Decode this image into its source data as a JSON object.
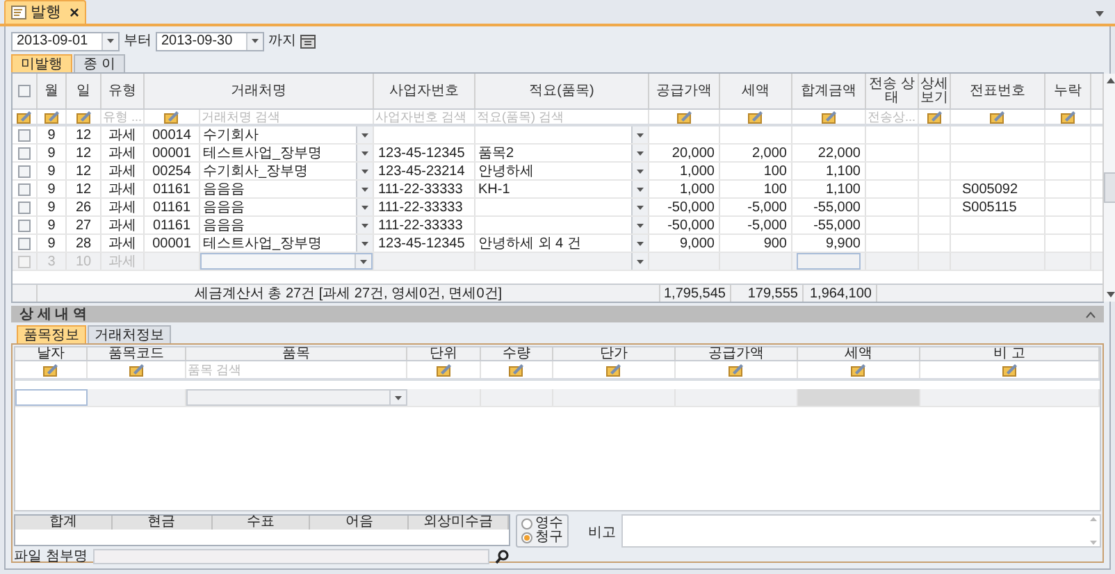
{
  "doc_tab": {
    "title": "발행",
    "close": "×",
    "selected": true
  },
  "period": {
    "from": "2013-09-01",
    "from_label": "부터",
    "to": "2013-09-30",
    "to_label": "까지"
  },
  "status_tabs": [
    {
      "label": "미발행",
      "selected": true
    },
    {
      "label": "종 이",
      "selected": false
    }
  ],
  "table": {
    "select_all_checked": false,
    "columns": [
      "월",
      "일",
      "유형",
      "거래처명",
      "사업자번호",
      "적요(품목)",
      "공급가액",
      "세액",
      "합계금액",
      "전송 상태",
      "상세 보기",
      "전표번호",
      "누락"
    ],
    "filters": [
      {
        "kind": "icon"
      },
      {
        "kind": "icon"
      },
      {
        "kind": "icon"
      },
      {
        "kind": "search",
        "placeholder": "유형 ..."
      },
      {
        "kind": "icon"
      },
      {
        "kind": "search",
        "placeholder": "거래처명 검색"
      },
      {
        "kind": "search",
        "placeholder": "사업자번호 검색"
      },
      {
        "kind": "search",
        "placeholder": "적요(품목) 검색"
      },
      {
        "kind": "icon"
      },
      {
        "kind": "icon"
      },
      {
        "kind": "icon"
      },
      {
        "kind": "search",
        "placeholder": "전송상..."
      },
      {
        "kind": "icon"
      },
      {
        "kind": "icon"
      },
      {
        "kind": "icon"
      }
    ],
    "rows": [
      {
        "kind": "data",
        "checked": false,
        "month": "9",
        "day": "12",
        "type": "과세",
        "code": "00014",
        "name": "수기회사",
        "bizno": "",
        "memo": "",
        "supply": "",
        "tax": "",
        "total": "",
        "slip": ""
      },
      {
        "kind": "data",
        "checked": false,
        "month": "9",
        "day": "12",
        "type": "과세",
        "code": "00001",
        "name": "테스트사업_장부명",
        "bizno": "123-45-12345",
        "memo": "품목2",
        "supply": "20,000",
        "tax": "2,000",
        "total": "22,000",
        "slip": ""
      },
      {
        "kind": "data",
        "checked": false,
        "month": "9",
        "day": "12",
        "type": "과세",
        "code": "00254",
        "name": "수기회사_장부명",
        "bizno": "123-45-23214",
        "memo": "안녕하세",
        "supply": "1,000",
        "tax": "100",
        "total": "1,100",
        "slip": ""
      },
      {
        "kind": "data",
        "checked": false,
        "month": "9",
        "day": "12",
        "type": "과세",
        "code": "01161",
        "name": "음음음",
        "bizno": "111-22-33333",
        "memo": "KH-1",
        "supply": "1,000",
        "tax": "100",
        "total": "1,100",
        "slip": "S005092"
      },
      {
        "kind": "data",
        "checked": false,
        "month": "9",
        "day": "26",
        "type": "과세",
        "code": "01161",
        "name": "음음음",
        "bizno": "111-22-33333",
        "memo": "",
        "supply": "-50,000",
        "tax": "-5,000",
        "total": "-55,000",
        "slip": "S005115"
      },
      {
        "kind": "data",
        "checked": false,
        "month": "9",
        "day": "27",
        "type": "과세",
        "code": "01161",
        "name": "음음음",
        "bizno": "111-22-33333",
        "memo": "",
        "supply": "-50,000",
        "tax": "-5,000",
        "total": "-55,000",
        "slip": ""
      },
      {
        "kind": "data",
        "checked": false,
        "month": "9",
        "day": "28",
        "type": "과세",
        "code": "00001",
        "name": "테스트사업_장부명",
        "bizno": "123-45-12345",
        "memo": "안녕하세 외 4 건",
        "supply": "9,000",
        "tax": "900",
        "total": "9,900",
        "slip": ""
      },
      {
        "kind": "new",
        "checked": false,
        "month": "3",
        "day": "10",
        "type": "과세",
        "code": "",
        "name": "",
        "bizno": "",
        "memo": "",
        "supply": "",
        "tax": "",
        "total": "",
        "slip": ""
      }
    ],
    "summary": {
      "text": "세금계산서 총 27건 [과세 27건, 영세0건, 면세0건]",
      "supply": "1,795,545",
      "tax": "179,555",
      "total": "1,964,100"
    }
  },
  "detail": {
    "title": "상 세 내 역",
    "tabs": [
      {
        "label": "품목정보",
        "selected": true
      },
      {
        "label": "거래처정보",
        "selected": false
      }
    ],
    "columns": [
      "날자",
      "품목코드",
      "품목",
      "단위",
      "수량",
      "단가",
      "공급가액",
      "세액",
      "비 고"
    ],
    "filters": [
      {
        "kind": "icon"
      },
      {
        "kind": "icon"
      },
      {
        "kind": "search",
        "placeholder": "품목 검색"
      },
      {
        "kind": "icon"
      },
      {
        "kind": "icon"
      },
      {
        "kind": "icon"
      },
      {
        "kind": "icon"
      },
      {
        "kind": "icon"
      },
      {
        "kind": "icon"
      }
    ]
  },
  "payment": {
    "columns": [
      "합계",
      "현금",
      "수표",
      "어음",
      "외상미수금"
    ]
  },
  "receipt_type": [
    {
      "label": "영수",
      "selected": false
    },
    {
      "label": "청구",
      "selected": true
    }
  ],
  "note_label": "비고",
  "attachment_label": "파일 첨부명"
}
